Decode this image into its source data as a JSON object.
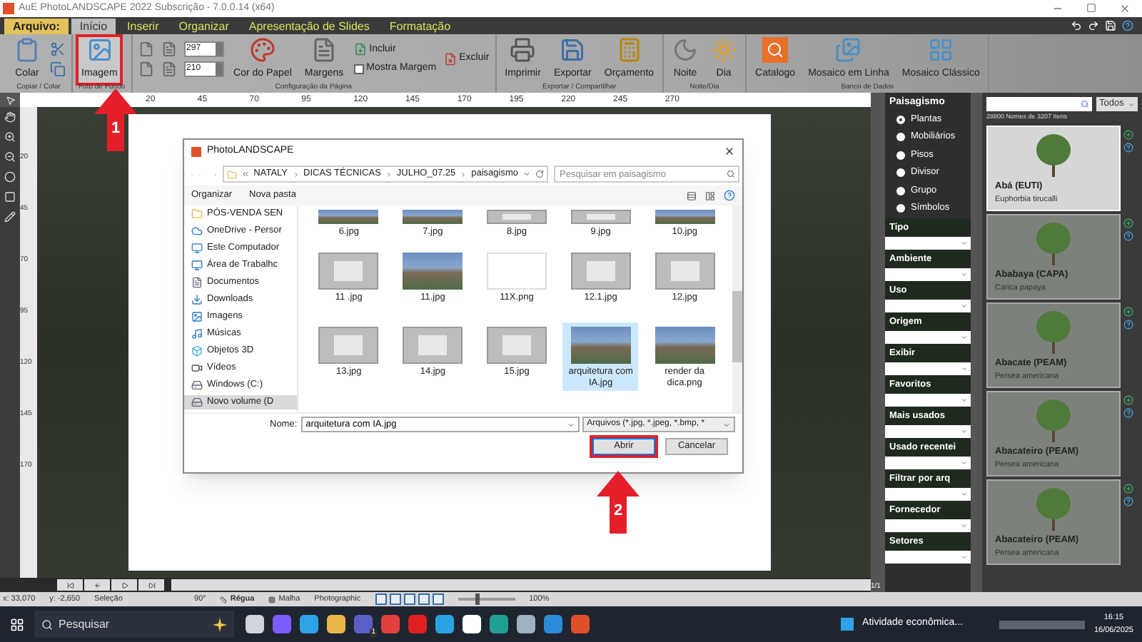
{
  "window": {
    "title": "AuE PhotoLANDSCAPE 2022 Subscrição - 7.0.0.14 (x64)"
  },
  "menu_tabs": [
    {
      "label": "Arquivo:",
      "kind": "file",
      "selected": false
    },
    {
      "label": "Início",
      "kind": "tab",
      "selected": true
    },
    {
      "label": "Inserir",
      "kind": "tab",
      "selected": false
    },
    {
      "label": "Organizar",
      "kind": "tab",
      "selected": false
    },
    {
      "label": "Apresentação de Slides",
      "kind": "tab",
      "selected": false
    },
    {
      "label": "Formatação",
      "kind": "tab",
      "selected": false
    }
  ],
  "ribbon": {
    "groups": [
      {
        "label": "Copiar / Colar",
        "columns": [
          [
            {
              "kind": "large",
              "label": "Colar"
            }
          ],
          [
            {
              "kind": "icon"
            },
            {
              "kind": "icon"
            }
          ]
        ]
      },
      {
        "label": "Foto de Fundo",
        "columns": [
          [
            {
              "kind": "large",
              "label": "Imagem",
              "highlighted": true
            }
          ]
        ]
      },
      {
        "label": "Configuração da Página",
        "columns": [
          [
            {
              "kind": "icon"
            },
            {
              "kind": "icon"
            }
          ],
          [
            {
              "kind": "icon"
            },
            {
              "kind": "icon"
            }
          ],
          [
            {
              "kind": "spin",
              "value": "297"
            },
            {
              "kind": "spin",
              "value": "210"
            }
          ],
          [
            {
              "kind": "large",
              "label": "Cor do Papel"
            }
          ],
          [
            {
              "kind": "large",
              "label": "Margens"
            }
          ],
          [
            {
              "kind": "small",
              "label": "Incluir"
            },
            {
              "kind": "check",
              "label": "Mostra Margem",
              "checked": false
            }
          ],
          [
            {
              "kind": "small",
              "label": "Excluir"
            }
          ]
        ]
      },
      {
        "label": "Exportar / Compartilhar",
        "columns": [
          [
            {
              "kind": "large",
              "label": "Imprimir"
            }
          ],
          [
            {
              "kind": "large",
              "label": "Exportar"
            }
          ],
          [
            {
              "kind": "large",
              "label": "Orçamento"
            }
          ]
        ]
      },
      {
        "label": "Noite/Dia",
        "columns": [
          [
            {
              "kind": "large",
              "label": "Noite"
            }
          ],
          [
            {
              "kind": "large",
              "label": "Dia"
            }
          ]
        ]
      },
      {
        "label": "Banco de Dados",
        "columns": [
          [
            {
              "kind": "large",
              "label": "Catalogo"
            }
          ],
          [
            {
              "kind": "large",
              "label": "Mosaico em Linha"
            }
          ],
          [
            {
              "kind": "large",
              "label": "Mosaico Clássico"
            }
          ]
        ]
      }
    ]
  },
  "ruler": {
    "h_ticks": [
      "20",
      "45",
      "70",
      "95",
      "120",
      "145",
      "170",
      "195",
      "220",
      "245",
      "270"
    ],
    "v_ticks": [
      "20",
      "45",
      "70",
      "95",
      "120",
      "145",
      "170"
    ]
  },
  "dialog": {
    "title": "PhotoLANDSCAPE",
    "address": [
      "NATALY",
      "DICAS TÉCNICAS",
      "JULHO_07.25",
      "paisagismo"
    ],
    "search_placeholder": "Pesquisar em paisagismo",
    "toolbar": [
      "Organizar",
      "Nova pasta"
    ],
    "nav": [
      {
        "label": "PÓS-VENDA SEN",
        "kind": "folder",
        "selected": false
      },
      {
        "label": "OneDrive - Persor",
        "kind": "cloud",
        "selected": false
      },
      {
        "label": "Este Computador",
        "kind": "pc",
        "selected": false
      },
      {
        "label": "Área de Trabalhc",
        "kind": "desktop",
        "selected": false
      },
      {
        "label": "Documentos",
        "kind": "docs",
        "selected": false
      },
      {
        "label": "Downloads",
        "kind": "download",
        "selected": false
      },
      {
        "label": "Imagens",
        "kind": "images",
        "selected": false
      },
      {
        "label": "Músicas",
        "kind": "music",
        "selected": false
      },
      {
        "label": "Objetos 3D",
        "kind": "cube",
        "selected": false
      },
      {
        "label": "Vídeos",
        "kind": "video",
        "selected": false
      },
      {
        "label": "Windows (C:)",
        "kind": "drive",
        "selected": false
      },
      {
        "label": "Novo volume (D",
        "kind": "drive",
        "selected": true
      }
    ],
    "files": [
      {
        "name": "6.jpg",
        "kind": "render",
        "selected": false
      },
      {
        "name": "7.jpg",
        "kind": "render",
        "selected": false
      },
      {
        "name": "8.jpg",
        "kind": "screenshot",
        "selected": false
      },
      {
        "name": "9.jpg",
        "kind": "screenshot",
        "selected": false
      },
      {
        "name": "10.jpg",
        "kind": "render",
        "selected": false
      },
      {
        "name": "11 .jpg",
        "kind": "screenshot",
        "selected": false
      },
      {
        "name": "11.jpg",
        "kind": "render",
        "selected": false
      },
      {
        "name": "11X.png",
        "kind": "blank",
        "selected": false
      },
      {
        "name": "12.1.jpg",
        "kind": "screenshot",
        "selected": false
      },
      {
        "name": "12.jpg",
        "kind": "screenshot",
        "selected": false
      },
      {
        "name": "13.jpg",
        "kind": "screenshot",
        "selected": false
      },
      {
        "name": "14.jpg",
        "kind": "screenshot",
        "selected": false
      },
      {
        "name": "15.jpg",
        "kind": "screenshot",
        "selected": false
      },
      {
        "name": "arquitetura com IA.jpg",
        "kind": "render",
        "selected": true
      },
      {
        "name": "render da dica.png",
        "kind": "render",
        "selected": false
      }
    ],
    "name_label": "Nome:",
    "name_value": "arquitetura com IA.jpg",
    "filter": "Arquivos (*.jpg, *.jpeg, *.bmp, *",
    "buttons": [
      {
        "label": "Abrir",
        "kind": "primary",
        "highlighted": true
      },
      {
        "label": "Cancelar",
        "kind": "normal",
        "highlighted": false
      }
    ]
  },
  "callouts": [
    {
      "number": "1"
    },
    {
      "number": "2"
    }
  ],
  "panel": {
    "category": "Paisagismo",
    "radios": [
      {
        "label": "Plantas",
        "selected": true
      },
      {
        "label": "Mobiliários",
        "selected": false
      },
      {
        "label": "Pisos",
        "selected": false
      },
      {
        "label": "Divisor",
        "selected": false
      },
      {
        "label": "Grupo",
        "selected": false
      },
      {
        "label": "Símbolos",
        "selected": false
      }
    ],
    "filters": [
      "Tipo",
      "Ambiente",
      "Uso",
      "Origem",
      "Exibir",
      "Favoritos",
      "Mais usados",
      "Usado recentei",
      "Filtrar por arq",
      "Fornecedor",
      "Setores"
    ],
    "scope": "Todos",
    "count": "28800 Nomes de 3207 Itens",
    "page": "1/1",
    "cards": [
      {
        "name": "Abá (EUTI)",
        "species": "Euphorbia tirucalli",
        "selected": true
      },
      {
        "name": "Ababaya (CAPA)",
        "species": "Carica papaya",
        "selected": false
      },
      {
        "name": "Abacate (PEAM)",
        "species": "Persea americana",
        "selected": false
      },
      {
        "name": "Abacateiro (PEAM)",
        "species": "Persea americana",
        "selected": false
      },
      {
        "name": "Abacateiro (PEAM)",
        "species": "Persea americana",
        "selected": false
      }
    ]
  },
  "status_bar": {
    "x": "x: 33,070",
    "y": "y: -2,650",
    "mode": "Seleção",
    "angle": "90°",
    "toggles": [
      {
        "label": "Régua",
        "on": true
      },
      {
        "label": "Malha",
        "on": false
      }
    ],
    "render": "Photographic",
    "zoom": {
      "level": 0.3,
      "reading": "100%"
    }
  },
  "taskbar": {
    "search": "Pesquisar",
    "badge": "1",
    "news": "Atividade econômica...",
    "time": "16:15",
    "date": "16/06/2025"
  }
}
